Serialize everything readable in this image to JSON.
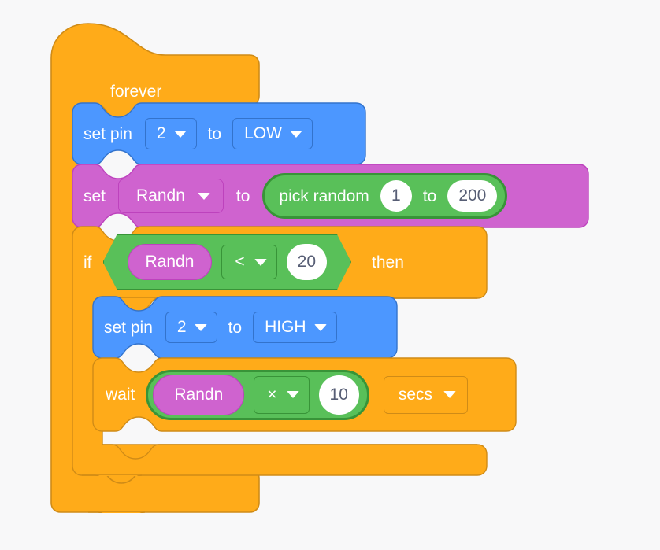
{
  "workspace": {
    "background_color": "#F8F8F9",
    "palette": {
      "control": "#FFAB19",
      "control_border": "#CF8B17",
      "pins": "#4C97FF",
      "pins_border": "#3373CC",
      "variables": "#CF63CF",
      "variables_border": "#BD42BD",
      "operators": "#59C059",
      "operators_border": "#389438",
      "input_text": "#575E75",
      "label_text": "#FFFFFF"
    }
  },
  "script": {
    "forever": {
      "label": "forever"
    },
    "set_pin_low": {
      "prefix_label": "set pin",
      "pin_value": "2",
      "middle_label": "to",
      "level_value": "LOW",
      "dropdown_icon": "chevron-down-icon"
    },
    "set_variable": {
      "prefix_label": "set",
      "variable_value": "Randn",
      "middle_label": "to",
      "value_block": {
        "label": "pick random",
        "from_value": "1",
        "to_label": "to",
        "to_value": "200"
      }
    },
    "if_then": {
      "prefix_label": "if",
      "suffix_label": "then",
      "condition": {
        "left_operand": "Randn",
        "operator": "<",
        "right_operand": "20"
      }
    },
    "set_pin_high": {
      "prefix_label": "set pin",
      "pin_value": "2",
      "middle_label": "to",
      "level_value": "HIGH",
      "dropdown_icon": "chevron-down-icon"
    },
    "wait": {
      "prefix_label": "wait",
      "expression": {
        "left_operand": "Randn",
        "operator": "×",
        "right_operand": "10"
      },
      "units_value": "secs"
    }
  }
}
